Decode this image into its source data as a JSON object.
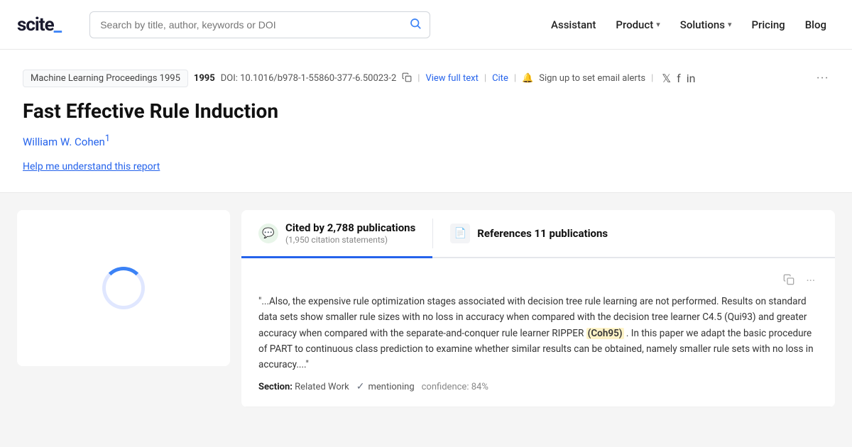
{
  "nav": {
    "logo_text": "scite_",
    "search_placeholder": "Search by title, author, keywords or DOI",
    "links": [
      {
        "label": "Assistant",
        "has_dropdown": false
      },
      {
        "label": "Product",
        "has_dropdown": true
      },
      {
        "label": "Solutions",
        "has_dropdown": true
      },
      {
        "label": "Pricing",
        "has_dropdown": false
      },
      {
        "label": "Blog",
        "has_dropdown": false
      }
    ]
  },
  "article": {
    "journal_tag": "Machine Learning Proceedings 1995",
    "year": "1995",
    "doi_prefix": "DOI: ",
    "doi": "10.1016/b978-1-55860-377-6.50023-2",
    "view_full_text": "View full text",
    "cite": "Cite",
    "alert_label": "Sign up to set email alerts",
    "title": "Fast Effective Rule Induction",
    "author": "William W. Cohen",
    "author_superscript": "1",
    "help_link": "Help me understand this report"
  },
  "tabs": [
    {
      "id": "cited-by",
      "icon": "💬",
      "icon_bg": "green",
      "main_label": "Cited by 2,788 publications",
      "sub_label": "(1,950 citation statements)",
      "active": true
    },
    {
      "id": "references",
      "icon": "📄",
      "icon_bg": "gray",
      "main_label": "References 11 publications",
      "sub_label": "",
      "active": false
    }
  ],
  "citation_card": {
    "quote": "\"...Also, the expensive rule optimization stages associated with decision tree rule learning are not performed. Results on standard data sets show smaller rule sizes with no loss in accuracy when compared with the decision tree learner C4.5 (Qui93) and greater accuracy when compared with the separate-and-conquer rule learner RIPPER ",
    "highlight": "(Coh95)",
    "quote_end": " . In this paper we adapt the basic procedure of PART to continuous class prediction to examine whether similar results can be obtained, namely smaller rule sets with no loss in accuracy....\"",
    "section_label": "Section:",
    "section_value": "Related Work",
    "mentioning_label": "mentioning",
    "confidence_label": "confidence: 84%"
  },
  "more_label": "···"
}
